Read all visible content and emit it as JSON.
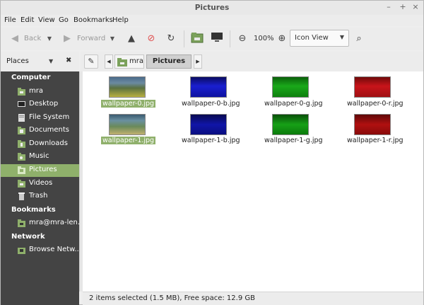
{
  "window": {
    "title": "Pictures",
    "controls": [
      "–",
      "+",
      "×"
    ]
  },
  "menubar": {
    "items": [
      "File",
      "Edit",
      "View",
      "Go",
      "Bookmarks",
      "Help"
    ]
  },
  "toolbar": {
    "back_label": "Back",
    "forward_label": "Forward",
    "zoom_level": "100%",
    "view_mode": "Icon View",
    "icons": [
      "back-arrow-icon",
      "dropdown-arrow-icon",
      "forward-arrow-icon",
      "dropdown-arrow-icon",
      "up-arrow-icon",
      "stop-icon",
      "reload-icon",
      "home-folder-icon",
      "computer-icon",
      "zoom-out-icon",
      "zoom-in-icon",
      "search-icon"
    ]
  },
  "sidebar_header": {
    "label": "Places",
    "close": "✖"
  },
  "pathbar": {
    "segments": [
      "mra",
      "Pictures"
    ],
    "active": "Pictures"
  },
  "sidebar": {
    "sections": [
      {
        "title": "Computer",
        "items": [
          {
            "label": "mra",
            "icon": "home-folder-icon"
          },
          {
            "label": "Desktop",
            "icon": "desktop-icon"
          },
          {
            "label": "File System",
            "icon": "drive-icon"
          },
          {
            "label": "Documents",
            "icon": "folder-icon"
          },
          {
            "label": "Downloads",
            "icon": "folder-icon"
          },
          {
            "label": "Music",
            "icon": "folder-icon"
          },
          {
            "label": "Pictures",
            "icon": "folder-icon",
            "selected": true
          },
          {
            "label": "Videos",
            "icon": "folder-icon"
          },
          {
            "label": "Trash",
            "icon": "trash-icon"
          }
        ]
      },
      {
        "title": "Bookmarks",
        "items": [
          {
            "label": "mra@mra-len...",
            "icon": "network-folder-icon"
          }
        ]
      },
      {
        "title": "Network",
        "items": [
          {
            "label": "Browse Netw...",
            "icon": "network-icon"
          }
        ]
      }
    ]
  },
  "files": [
    {
      "name": "wallpaper-0.jpg",
      "selected": true,
      "color": "#7d8a4a"
    },
    {
      "name": "wallpaper-0-b.jpg",
      "selected": false,
      "color": "#1a1fd0"
    },
    {
      "name": "wallpaper-0-g.jpg",
      "selected": false,
      "color": "#1aa81a"
    },
    {
      "name": "wallpaper-0-r.jpg",
      "selected": false,
      "color": "#c8141a"
    },
    {
      "name": "wallpaper-1.jpg",
      "selected": true,
      "color": "#5d8a6a"
    },
    {
      "name": "wallpaper-1-b.jpg",
      "selected": false,
      "color": "#1015a8"
    },
    {
      "name": "wallpaper-1-g.jpg",
      "selected": false,
      "color": "#16a016"
    },
    {
      "name": "wallpaper-1-r.jpg",
      "selected": false,
      "color": "#b01010"
    }
  ],
  "status": {
    "text": "2 items selected (1.5 MB), Free space: 12.9 GB"
  },
  "colors": {
    "accent": "#8fb06b",
    "sidebar_bg": "#444444"
  }
}
